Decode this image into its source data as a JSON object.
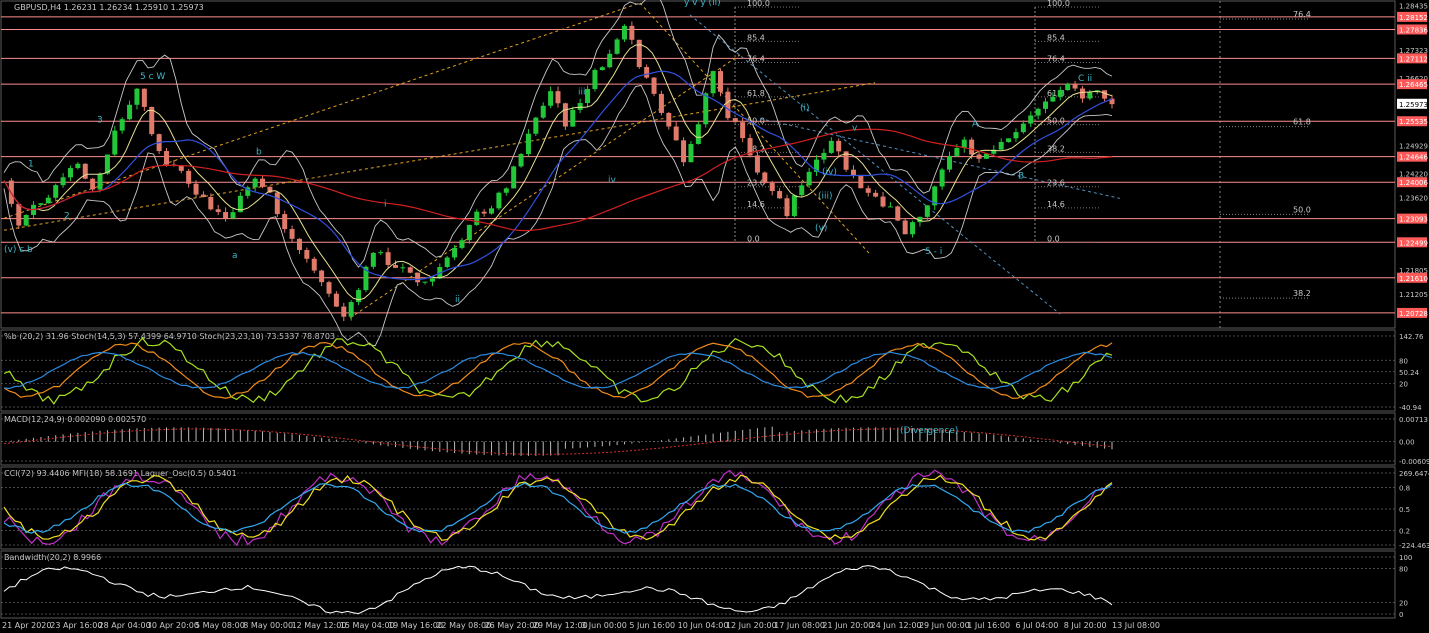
{
  "chart_data": {
    "type": "candlestick",
    "symbol_header": "GBPUSD,H4  1.26231 1.26234 1.25910 1.25973",
    "price_axis": [
      "1.28435",
      "1.28152",
      "1.27836",
      "1.27323",
      "1.27112",
      "1.26620",
      "1.26465",
      "1.25973",
      "1.25535",
      "1.24929",
      "1.24646",
      "1.24220",
      "1.24006",
      "1.23620",
      "1.23093",
      "1.22499",
      "1.21805",
      "1.21610",
      "1.21205",
      "1.20728"
    ],
    "price_ylim": [
      1.2035,
      1.2855
    ],
    "current_price": "1.25973",
    "horizontal_levels": [
      {
        "price": 1.28152,
        "label": "1.28152"
      },
      {
        "price": 1.27836,
        "label": "1.27836"
      },
      {
        "price": 1.27112,
        "label": "1.27112"
      },
      {
        "price": 1.26465,
        "label": "1.26465"
      },
      {
        "price": 1.25535,
        "label": "1.25535"
      },
      {
        "price": 1.24646,
        "label": "1.24646"
      },
      {
        "price": 1.24006,
        "label": "1.24006"
      },
      {
        "price": 1.23093,
        "label": "1.23093"
      },
      {
        "price": 1.22499,
        "label": "1.22499"
      },
      {
        "price": 1.2161,
        "label": "1.21610"
      },
      {
        "price": 1.20728,
        "label": "1.20728"
      }
    ],
    "fib_left": [
      "100.0",
      "85.4",
      "76.4",
      "61.8",
      "50.0",
      "38.2",
      "23.6",
      "14.6",
      "0.0"
    ],
    "fib_right": [
      "100.0",
      "85.4",
      "76.4",
      "61.8",
      "50.0",
      "38.2",
      "23.6",
      "14.6",
      "0.0"
    ],
    "fib_ext": [
      "76.4",
      "61.8",
      "50.0",
      "38.2"
    ],
    "time_axis": [
      "21 Apr 2020",
      "23 Apr 16:00",
      "28 Apr 04:00",
      "30 Apr 20:00",
      "5 May 08:00",
      "8 May 00:00",
      "12 May 12:00",
      "15 May 04:00",
      "19 May 16:00",
      "22 May 08:00",
      "26 May 20:00",
      "29 May 12:00",
      "3 Jun 00:00",
      "5 Jun 16:00",
      "10 Jun 04:00",
      "12 Jun 20:00",
      "17 Jun 08:00",
      "21 Jun 20:00",
      "24 Jun 12:00",
      "29 Jun 00:00",
      "1 Jul 16:00",
      "6 Jul 04:00",
      "8 Jul 20:00",
      "13 Jul 08:00"
    ],
    "wave_labels": [
      "5 c W",
      "(v) c b",
      "b",
      "a",
      "3",
      "2",
      "1",
      "i",
      "ii",
      "iii",
      "iv",
      "y v y (ii)",
      "(i)",
      "(iii)",
      "(iv)",
      "(v)",
      "v",
      "A",
      "B",
      "C ii",
      "5 - i"
    ],
    "annotation": "(Divergence)",
    "panels": [
      {
        "id": "stoch",
        "title": "%b (20,2) 31.96  Stoch(14,5,3) 57.4399 64.9710  Stoch(23,23,10) 73.5337 78.8703",
        "ticks": [
          "142.76",
          "80",
          "50.24",
          "20",
          "-40.94"
        ],
        "ylim": [
          -40.94,
          142.76
        ]
      },
      {
        "id": "macd",
        "title": "MACD(12,24,9) 0.002090 0.002570",
        "ticks": [
          "0.00713",
          "0.00",
          "-0.006097"
        ],
        "ylim": [
          -0.006097,
          0.00713
        ]
      },
      {
        "id": "cci",
        "title": "CCI(72) 93.4406  MFI(18) 58.1691  Laguer_Osc(0.5) 0.5401",
        "ticks": [
          "269.6474",
          "0.8",
          "0.5",
          "0.2",
          "-224.4636"
        ],
        "ylim": [
          -224.4636,
          269.6474
        ]
      },
      {
        "id": "bw",
        "title": "Bandwidth(20,2) 8.9966",
        "ticks": [
          "100",
          "80",
          "20",
          "0"
        ],
        "ylim": [
          0,
          100
        ]
      }
    ],
    "close_path": [
      [
        0,
        1.2405
      ],
      [
        8,
        1.229
      ],
      [
        16,
        1.234
      ],
      [
        24,
        1.237
      ],
      [
        32,
        1.242
      ],
      [
        40,
        1.245
      ],
      [
        48,
        1.238
      ],
      [
        56,
        1.248
      ],
      [
        64,
        1.256
      ],
      [
        72,
        1.264
      ],
      [
        80,
        1.252
      ],
      [
        88,
        1.245
      ],
      [
        96,
        1.243
      ],
      [
        104,
        1.238
      ],
      [
        112,
        1.234
      ],
      [
        120,
        1.231
      ],
      [
        128,
        1.236
      ],
      [
        136,
        1.241
      ],
      [
        144,
        1.237
      ],
      [
        152,
        1.229
      ],
      [
        160,
        1.223
      ],
      [
        168,
        1.218
      ],
      [
        176,
        1.212
      ],
      [
        184,
        1.206
      ],
      [
        192,
        1.214
      ],
      [
        200,
        1.223
      ],
      [
        208,
        1.22
      ],
      [
        216,
        1.218
      ],
      [
        224,
        1.215
      ],
      [
        232,
        1.216
      ],
      [
        240,
        1.222
      ],
      [
        248,
        1.225
      ],
      [
        256,
        1.232
      ],
      [
        264,
        1.234
      ],
      [
        272,
        1.239
      ],
      [
        280,
        1.247
      ],
      [
        288,
        1.256
      ],
      [
        296,
        1.263
      ],
      [
        304,
        1.255
      ],
      [
        312,
        1.26
      ],
      [
        320,
        1.268
      ],
      [
        328,
        1.272
      ],
      [
        336,
        1.28
      ],
      [
        344,
        1.27
      ],
      [
        352,
        1.262
      ],
      [
        360,
        1.255
      ],
      [
        368,
        1.246
      ],
      [
        376,
        1.255
      ],
      [
        384,
        1.268
      ],
      [
        392,
        1.257
      ],
      [
        400,
        1.252
      ],
      [
        408,
        1.242
      ],
      [
        416,
        1.238
      ],
      [
        424,
        1.232
      ],
      [
        432,
        1.24
      ],
      [
        440,
        1.246
      ],
      [
        448,
        1.251
      ],
      [
        456,
        1.244
      ],
      [
        464,
        1.239
      ],
      [
        472,
        1.237
      ],
      [
        480,
        1.233
      ],
      [
        488,
        1.227
      ],
      [
        496,
        1.231
      ],
      [
        504,
        1.238
      ],
      [
        512,
        1.247
      ],
      [
        520,
        1.25
      ],
      [
        528,
        1.246
      ],
      [
        536,
        1.249
      ],
      [
        544,
        1.252
      ],
      [
        552,
        1.254
      ],
      [
        560,
        1.259
      ],
      [
        568,
        1.261
      ],
      [
        576,
        1.265
      ],
      [
        584,
        1.26
      ],
      [
        592,
        1.264
      ],
      [
        600,
        1.2597
      ]
    ],
    "bar_count": 600,
    "grid": false,
    "theme": {
      "background": "#000000",
      "up": "#22c83a",
      "down": "#e07a6a",
      "level": "#ff8c8c",
      "ma_red": "#d22020",
      "ma_blue": "#3050e0",
      "text": "#c8c8c8",
      "wave": "#3fb6c8"
    }
  }
}
